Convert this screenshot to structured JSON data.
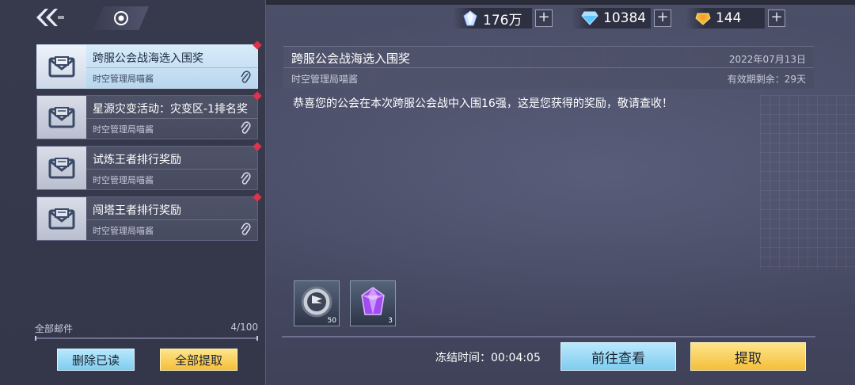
{
  "currencies": [
    {
      "icon": "crystal-icon",
      "value": "176万"
    },
    {
      "icon": "diamond-icon",
      "value": "10384"
    },
    {
      "icon": "gold-gem-icon",
      "value": "144"
    }
  ],
  "currency_plus": "+",
  "mail_list": [
    {
      "title": "跨服公会战海选入围奖",
      "sender": "时空管理局喵酱",
      "selected": true
    },
    {
      "title": "星源灾变活动：灾变区-1排名奖",
      "sender": "时空管理局喵酱",
      "selected": false
    },
    {
      "title": "试炼王者排行奖励",
      "sender": "时空管理局喵酱",
      "selected": false
    },
    {
      "title": "闯塔王者排行奖励",
      "sender": "时空管理局喵酱",
      "selected": false
    }
  ],
  "footer": {
    "all_mail_label": "全部邮件",
    "mail_count": "4/100",
    "delete_read_label": "删除已读",
    "claim_all_label": "全部提取"
  },
  "detail": {
    "title": "跨服公会战海选入围奖",
    "date": "2022年07月13日",
    "sender": "时空管理局喵酱",
    "validity": "有效期剩余：29天",
    "body": "恭喜您的公会在本次跨服公会战中入围16强，这是您获得的奖励，敬请查收！",
    "rewards": [
      {
        "icon": "guild-badge-icon",
        "count": "50"
      },
      {
        "icon": "purple-crystal-icon",
        "count": "3"
      }
    ],
    "freeze_time": "冻结时间：00:04:05",
    "goto_label": "前往查看",
    "claim_label": "提取"
  },
  "colors": {
    "selected_item": "#cfe6f8",
    "unread_dot": "#e0324b",
    "blue_button": "#7fcdf0",
    "yellow_button": "#f5bf3a"
  }
}
